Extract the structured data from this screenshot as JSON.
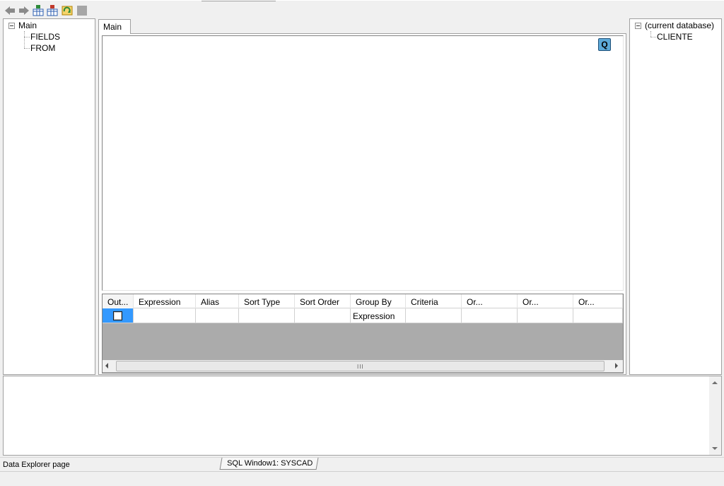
{
  "toolbar": {
    "buttons": [
      {
        "name": "back-arrow-icon",
        "color": "#8a8a8a"
      },
      {
        "name": "forward-arrow-icon",
        "color": "#8a8a8a"
      },
      {
        "name": "add-table-icon",
        "color": "#2e5fb0"
      },
      {
        "name": "remove-table-icon",
        "color": "#2e5fb0"
      },
      {
        "name": "refresh-icon",
        "color": "#d8a000"
      },
      {
        "name": "stop-icon",
        "color": "#9a9a9a"
      }
    ]
  },
  "left_tree": {
    "root": "Main",
    "children": [
      "FIELDS",
      "FROM"
    ]
  },
  "tabs": [
    {
      "label": "Main"
    }
  ],
  "canvas": {
    "query_button_label": "Q"
  },
  "grid": {
    "columns": [
      "Out...",
      "Expression",
      "Alias",
      "Sort Type",
      "Sort Order",
      "Group By",
      "Criteria",
      "Or...",
      "Or...",
      "Or..."
    ],
    "rows": [
      {
        "output_checked": false,
        "expression": "",
        "alias": "",
        "sort_type": "",
        "sort_order": "",
        "group_by": "Expression",
        "criteria": "",
        "or1": "",
        "or2": "",
        "or3": ""
      }
    ],
    "scroll_grip": "III"
  },
  "right_tree": {
    "root": "(current database)",
    "children": [
      "CLIENTE"
    ]
  },
  "status": {
    "text": "Data Explorer page",
    "document_tab": "SQL Window1: SYSCAD"
  },
  "colors": {
    "selection": "#3399ff",
    "grid_empty": "#ababab",
    "accent": "#5da9d8"
  }
}
